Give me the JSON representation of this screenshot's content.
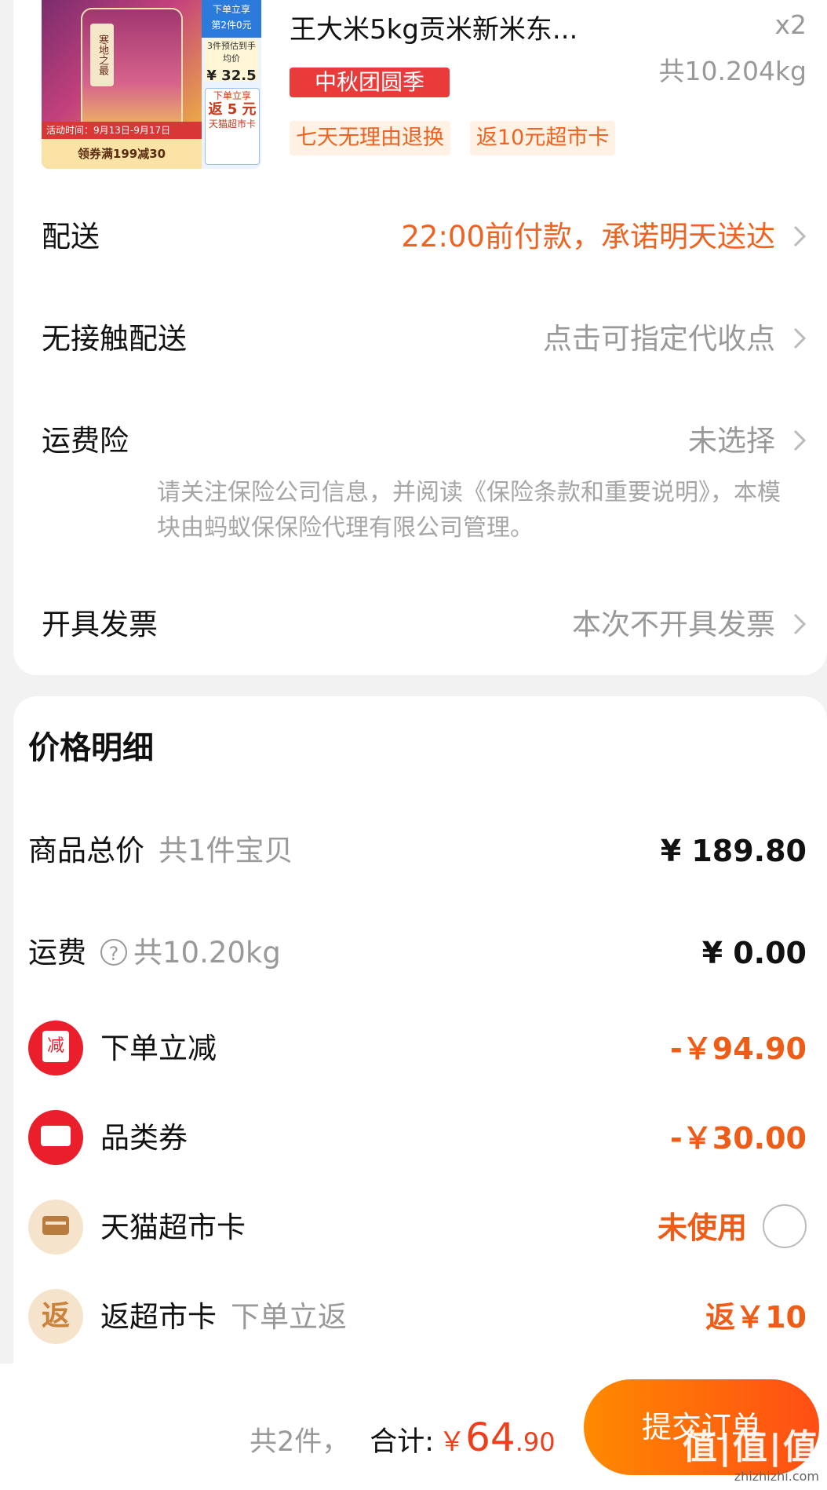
{
  "product": {
    "title": "王大米5kg贡米新米东...",
    "quantity": "x2",
    "weight": "共10.204kg",
    "promo_tag": "中秋团圆季",
    "service_tags": [
      "七天无理由退换",
      "返10元超市卡"
    ],
    "thumb": {
      "side_top": "下单立享",
      "side_top2": "第2件0元",
      "side_price_label": "3件预估到手均价",
      "side_price": "¥ 32.5",
      "side_card_l1": "下单立享",
      "side_card_l2": "返 5 元",
      "side_card_l3": "天猫超市卡",
      "bag_label": "寒地之最",
      "strip": "活动时间：9月13日-9月17日",
      "coupon": "领券满199减30"
    }
  },
  "options": {
    "delivery": {
      "label": "配送",
      "value": "22:00前付款，承诺明天送达"
    },
    "contactless": {
      "label": "无接触配送",
      "value": "点击可指定代收点"
    },
    "insurance": {
      "label": "运费险",
      "value": "未选择",
      "note": "请关注保险公司信息，并阅读《保险条款和重要说明》，本模块由蚂蚁保保险代理有限公司管理。"
    },
    "invoice": {
      "label": "开具发票",
      "value": "本次不开具发票"
    }
  },
  "price_detail": {
    "title": "价格明细",
    "goods_total": {
      "label": "商品总价",
      "sub": "共1件宝贝",
      "amount": "¥ 189.80"
    },
    "shipping": {
      "label": "运费",
      "help_icon": "?",
      "sub": "共10.20kg",
      "amount": "¥ 0.00"
    },
    "instant_discount": {
      "label": "下单立减",
      "icon": "减",
      "amount": "-￥94.90"
    },
    "category_coupon": {
      "label": "品类券",
      "amount": "-￥30.00"
    },
    "tmall_card": {
      "label": "天猫超市卡",
      "amount": "未使用"
    },
    "cashback_card": {
      "label": "返超市卡",
      "icon": "返",
      "sub": "下单立返",
      "amount": "返￥10"
    }
  },
  "footer": {
    "count": "共2件，",
    "total_label": "合计:",
    "currency": "￥",
    "total_int": "64",
    "total_dec": ".90",
    "submit": "提交订单",
    "watermark": "值|值|值",
    "watermark_url": "zhizhizhi.com"
  },
  "colors": {
    "accent": "#ee6321",
    "red": "#ea3b3b",
    "submit_start": "#ff8a00",
    "submit_end": "#ff4d15"
  }
}
